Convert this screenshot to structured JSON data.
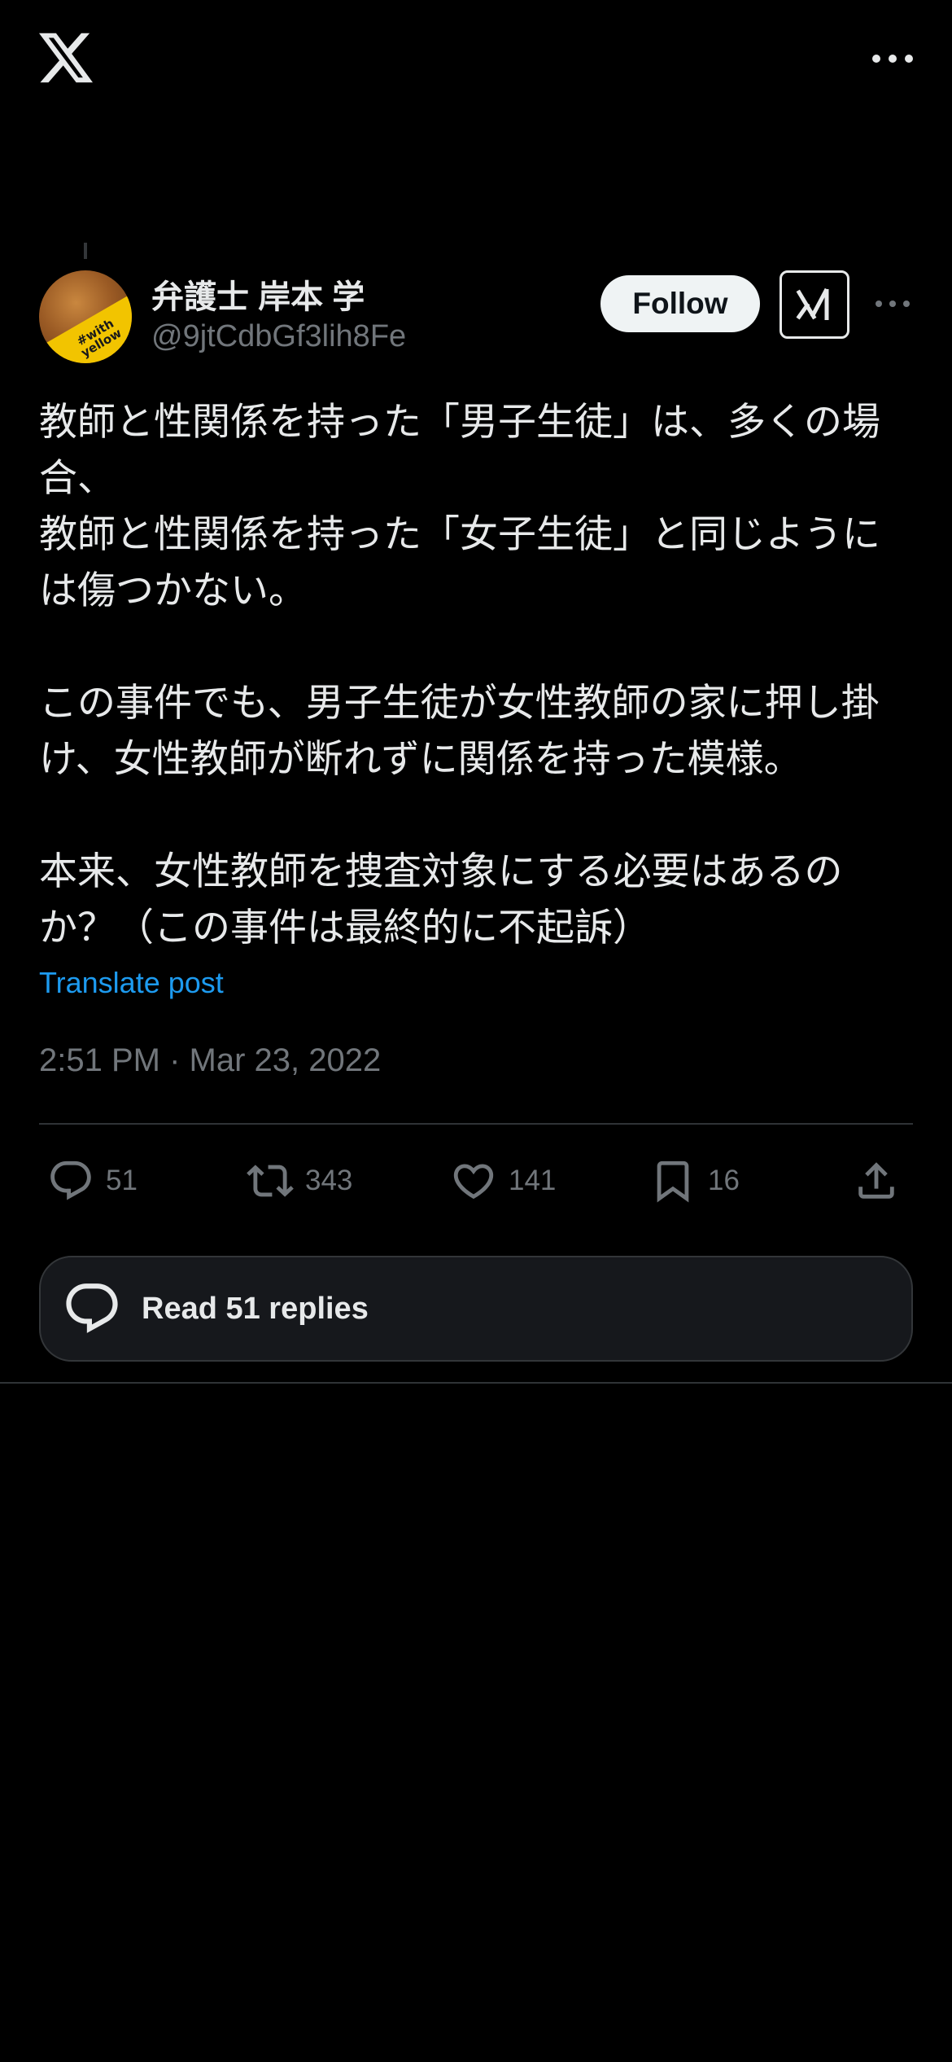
{
  "app": {
    "logo": "x-logo-icon"
  },
  "author": {
    "display_name": "弁護士 岸本 学",
    "handle": "@9jtCdbGf3lih8Fe",
    "avatar_badge_text": "#with yellow"
  },
  "header_actions": {
    "follow_label": "Follow",
    "grok_icon": "grok-icon",
    "more_icon": "more-horizontal-icon"
  },
  "post": {
    "paragraphs": [
      "教師と性関係を持った「男子生徒」は、多くの場合、",
      "教師と性関係を持った「女子生徒」と同じようには傷つかない。",
      "",
      "この事件でも、男子生徒が女性教師の家に押し掛け、女性教師が断れずに関係を持った模様。",
      "",
      "本来、女性教師を捜査対象にする必要はあるのか？（この事件は最終的に不起訴）"
    ],
    "translate_label": "Translate post",
    "timestamp": "2:51 PM · Mar 23, 2022"
  },
  "engagement": {
    "replies": "51",
    "reposts": "343",
    "likes": "141",
    "bookmarks": "16"
  },
  "read_replies_label": "Read 51 replies",
  "colors": {
    "background": "#000000",
    "text_primary": "#e7e9ea",
    "text_secondary": "#71767b",
    "link": "#1d9bf0",
    "divider": "#2f3336"
  }
}
